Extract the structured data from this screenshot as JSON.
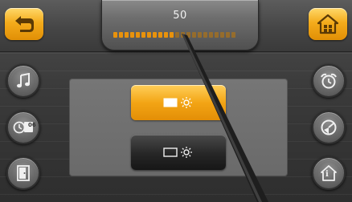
{
  "header": {
    "back_icon": "back-arrow-icon",
    "home_icon": "home-icon",
    "level": {
      "value": "50",
      "fraction": 0.5,
      "segments": 22
    }
  },
  "left_column": [
    {
      "icon": "music-note-icon"
    },
    {
      "icon": "clock-calendar-icon",
      "badge": "06"
    },
    {
      "icon": "door-icon"
    }
  ],
  "right_column": [
    {
      "icon": "alarm-clock-icon"
    },
    {
      "icon": "gauge-icon"
    },
    {
      "icon": "home-info-icon",
      "badge": "i"
    }
  ],
  "center": {
    "options": [
      {
        "icon": "screen-brightness-icon",
        "state": "selected"
      },
      {
        "icon": "screen-brightness-icon",
        "state": "unselected"
      }
    ]
  },
  "colors": {
    "accent": "#f3a515",
    "accent_dark": "#e18f06",
    "panel": "#6e6e6e",
    "background": "#3a3a3a"
  }
}
